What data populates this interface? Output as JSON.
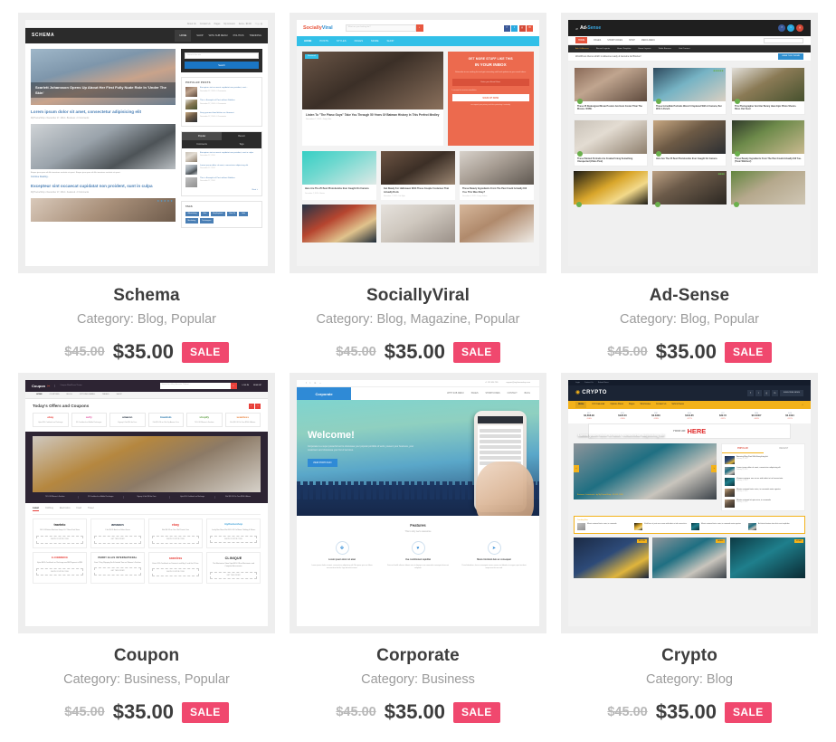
{
  "page": {
    "title": "Theme Shop Product Grid"
  },
  "products": [
    {
      "name": "Schema",
      "category_label": "Category: Blog, Popular",
      "old_price": "$45.00",
      "price": "$35.00",
      "sale_badge": "SALE",
      "theme": "schema",
      "preview": {
        "logo": "SCHEMA",
        "topbar_links": [
          "About Us",
          "Contact Us",
          "Pages",
          "My Account",
          "Items - $0.00"
        ],
        "nav": [
          "HOME",
          "SHOP",
          "WITH SUB MENU",
          "POLITICS",
          "TRENDING"
        ],
        "hero_headline": "Scarlett Johansson Opens Up About Her First Fully Nude Role In 'Under The Skin'",
        "post_title_1": "Lorem ipsum dolor sit amet, consectetur adipisicing elit",
        "post_meta_1": "MyThemeShop  •  December 17, 2014  •  Business  •  0 Comments",
        "post_excerpt": "Eaque ipsa quae ab illo inventore veritatis et quasi. Eaque ipsa quae ab illo inventore veritatis et quasi.",
        "read_more": "Continue Reading...",
        "post_title_2": "Excepteur sint occaecat cupidatat non proident, sunt in culpa",
        "post_meta_2": "MyThemeShop  •  December 17, 2014  •  Featured  •  0 Comments",
        "search_placeholder": "Search this site",
        "search_button": "Search",
        "widget_popular": "POPULAR POSTS",
        "popular_items": [
          "Excepteur sint occaecat cupidatat non proident, sunt...",
          "This is Example of Post without Sidebar",
          "Sexy gourmet food dishes on Gourmet"
        ],
        "tabs": [
          "Popular",
          "Recent",
          "Comments",
          "Tags"
        ],
        "tab_items": [
          "Excepteur sint occaecat cupidatat non proident, sunt in culpa",
          "Lorem ipsum dolor sit amet, consectetur adipisicing elit",
          "This is Example of Post without Sidebar"
        ],
        "next_link": "Next »",
        "widget_tags": "TAGS",
        "tags": [
          "Advertising",
          "Geo",
          "Employment",
          "How To",
          "Jobs",
          "Marketing",
          "Techniques"
        ]
      }
    },
    {
      "name": "SociallyViral",
      "category_label": "Category: Blog, Magazine, Popular",
      "old_price": "$45.00",
      "price": "$35.00",
      "sale_badge": "SALE",
      "theme": "sociallyviral",
      "preview": {
        "logo_a": "Socially",
        "logo_b": "Viral",
        "search_placeholder": "What are you looking for?",
        "nav": [
          "HOME",
          "POSTS",
          "STYLES",
          "PAGES",
          "MORE",
          "SHOP"
        ],
        "featured_badge": "Featured",
        "hero_title": "Listen To \"The Piano Guys\" Take You Through 50 Years Of Batman History In This Perfect Medley",
        "hero_meta": "December 7, 2015  •  Daily Vibe",
        "optin_line1": "GET MORE STUFF LIKE THIS",
        "optin_line2": "IN YOUR INBOX",
        "optin_desc": "Subscribe to our mailing list and get interesting stuff and updates to your email inbox.",
        "optin_input": "Enter your Email Here",
        "optin_consent": "I consent to receive newsletter",
        "optin_button": "SIGN UP NOW",
        "optin_note": "we respect your privacy and take protecting it seriously",
        "cards": [
          {
            "title": "Here Are The 25 Best Photobombs Ever Caught On Camera",
            "meta": "December 7, 2015  •  Stories"
          },
          {
            "title": "Get Ready For Halloween With These Couple Costumes That Actually Rock.",
            "meta": "November 7, 2015  •  Life Style"
          },
          {
            "title": "These Beauty Ingredients From The Past Could Actually Kill You. This Was Okay?",
            "meta": "December 4, 2015  •  Funny Videos"
          }
        ]
      }
    },
    {
      "name": "Ad-Sense",
      "category_label": "Category: Blog, Popular",
      "old_price": "$45.00",
      "price": "$35.00",
      "sale_badge": "SALE",
      "theme": "adsense",
      "preview": {
        "logo_a": "Ad-",
        "logo_b": "Sense",
        "nav": [
          "HOME",
          "PAGES",
          "SHORTCODES",
          "SHOP",
          "MEDIA MENU"
        ],
        "subnav": [
          "Ads & Adsense",
          "Recent Layouts",
          "Home Template",
          "Home Layouts",
          "Tablet Banners",
          "Grid Content"
        ],
        "notice": "WordPress theme which is Adsense ready & Genuine Ad Blocker!",
        "cta_button": "GRAB THIS THEME",
        "cards": [
          "These 25 Redesigned Movie Posters Are Even Cooler Than The Movies. WOW.",
          "These Incredible Portraits Weren't Captured With A Camera, But With A Pencil.",
          "This Photographer And Her Bunny Have Epic Photo Shoots. Bless Out Feed",
          "These Painted Portraits Are Created Using Something Unexpected (Video Post)",
          "Here Are The 25 Best Photobombs Ever Caught On Camera",
          "These Beauty Ingredients From The Past Could Actually Kill You. (Toxic Witches!)"
        ]
      }
    },
    {
      "name": "Coupon",
      "category_label": "Category: Business, Popular",
      "old_price": "$45.00",
      "price": "$35.00",
      "sale_badge": "SALE",
      "theme": "coupon",
      "preview": {
        "logo": "Coupon",
        "tagline": "Coupon WordPress Theme",
        "search_placeholder": "Search for eBay, Amazon, Flipkart...",
        "login": "LOG IN",
        "signup": "SIGN UP",
        "nav": [
          "HOME",
          "COUPONS",
          "BLOG",
          "OPTIONS PANEL",
          "PAGES",
          "SHOP"
        ],
        "heading": "Today's Offers and Coupons",
        "top_offers": [
          {
            "brand": "ebay",
            "desc": "Upto 40% Cashback on Recharge"
          },
          {
            "brand": "sulfy",
            "desc": "$5 Cashback on Mobile Recharges"
          },
          {
            "brand": "amazon",
            "desc": "Signup & Get $10 for Free"
          },
          {
            "brand": "travelolo",
            "desc": "Flat $20 Off on Ola City Amaze Cars"
          },
          {
            "brand": "shopify",
            "desc": "70% Off Women's Fashion"
          },
          {
            "brand": "seamless",
            "desc": "Flat $20 Off On Your $200 & Above"
          }
        ],
        "tabs": [
          "Latest",
          "Clothing",
          "Electronics",
          "Food",
          "Travel"
        ],
        "coupons": [
          {
            "brand": "traeteio",
            "desc": "10% Off Entire Machine Group LLC Store First Store",
            "btn": "SHOW COUPON CODE"
          },
          {
            "brand": "amazon",
            "desc": "3 for $9.99 Each on Select Items",
            "btn": "GET THIS OFFER"
          },
          {
            "brand": "ebay",
            "desc": "Flat $6 Off on One Ola Private Cars",
            "btn": "SHOW COUPON CODE"
          },
          {
            "brand": "mythemeshop",
            "desc": "Lucky Star Store Flat 50% Off On Mens Clothing & Shoes",
            "btn": "SHOW COUPON CODE"
          },
          {
            "brand": "E-COMMERCE",
            "desc": "Upto 400% Cashback on Recharge and Bill Payment of $20",
            "btn": "SHOW COUPON CODE"
          },
          {
            "brand": "PERRY ELLIS INTERNATIONAL",
            "desc": "Free 2 Day Shipping For A Limited Time on Women's Fashion",
            "btn": "GET THIS OFFER"
          },
          {
            "brand": "seamless",
            "desc": "Extra 10% Cashback on Domino's and Buy 1 and Get 1 Free",
            "btn": "SHOW COUPON CODE"
          },
          {
            "brand": "CLINIQUE",
            "desc": "The Electronics Store Upto 80% Off on Electronics and Computer Accessories",
            "btn": "GET THIS OFFER"
          }
        ]
      }
    },
    {
      "name": "Corporate",
      "category_label": "Category: Business",
      "old_price": "$45.00",
      "price": "$35.00",
      "sale_badge": "SALE",
      "theme": "corporate",
      "preview": {
        "logo": "Corporate",
        "topbar_phone": "+1 123 456 789",
        "topbar_email": "support@mythemeshop.com",
        "nav": [
          "WITH SUB MENU",
          "PAGES",
          "SHORTCODES",
          "CONTACT",
          "BLOG"
        ],
        "hero_title": "Welcome!",
        "hero_desc": "Corporate is a super powerful tool to showcase your popular portfolio of work, present your business, your customers and showcase your list of services.",
        "hero_button": "VIEW PORTFOLIO",
        "features_title": "Features",
        "features_sub": "This is why we're awesome",
        "features": [
          {
            "title": "Lorem ipsum dolor sit amet",
            "desc": "Lorem ipsum dolor sit amet, consectetur adipisicing elit. Nisi quae quis nisi libero accusantium facilis, fuga ad amet earum."
          },
          {
            "title": "Use conditioned cupiditat",
            "desc": "Duis sed mollit ullamco laboris nisi ut aliquip ex ea commodo consequat deserunt voluptate."
          },
          {
            "title": "Mavis tincidunt duis ac consequat",
            "desc": "Proin bibendum, dui ac consequat viverra, ipsum est lobortis ut magna, quis tincidunt neque mauris non sed."
          }
        ]
      }
    },
    {
      "name": "Crypto",
      "category_label": "Category: Blog",
      "old_price": "$45.00",
      "price": "$35.00",
      "sale_badge": "SALE",
      "theme": "crypto",
      "preview": {
        "topbar_links": [
          "Login",
          "Contact Us",
          "Submit News"
        ],
        "logo": "CRYPTO",
        "header_button": "SUBSCRIBE NEWS",
        "nav": [
          "Home",
          "ICO Calendar",
          "Options Panel",
          "Pages",
          "Shortcodes",
          "Contact Us",
          "Submit News"
        ],
        "ticker": [
          {
            "symbol": "BTC",
            "price": "$3,668.99",
            "change": "-1.06%"
          },
          {
            "symbol": "ETH",
            "price": "$126.00",
            "change": "-1.94%"
          },
          {
            "symbol": "XRP",
            "price": "$0.3329",
            "change": "-1.28%"
          },
          {
            "symbol": "BCH",
            "price": "$134.85",
            "change": "-3.77%"
          },
          {
            "symbol": "LTC",
            "price": "$32.15",
            "change": "-1.87%"
          },
          {
            "symbol": "XEM",
            "price": "$0.04307",
            "change": "-3.43%"
          },
          {
            "symbol": "XLM",
            "price": "$0.1094",
            "change": "-2.17%"
          }
        ],
        "ad_line1": "YOUR AD",
        "ad_line2": "HERE",
        "hero_title": "Lorem ipsum dolor sit amet, consectetur adipisicing elit",
        "hero_meta": "Business, Investment  •  by MyThemeShop  •  19,419, 2018",
        "sidebar_tabs": [
          "POPULAR",
          "RECENT"
        ],
        "sidebar_items": [
          "Amazing Blog Post With Everything Init",
          "Lorem ipsum dolor sit amet, consectetur adipisicing elit",
          "Vivamus quisque non eu mo mibi viderit et ad consectetur",
          "Mauris euismod tortor enim, in commodo enim egestas",
          "Mauris euismod sit quis enim, in commodo"
        ],
        "trending_label": "Trending Now",
        "trending": [
          "Mauris euismod tortor enim, in commodo",
          "Vivid lines ut justo nec ornare mibi vderis et ad consectetur.",
          "Mauris euismod tortor enim, in commodo enim egestas",
          "Architecto beatae vitae dicta sunt explicabo"
        ],
        "card_tags": [
          "BITCOIN",
          "MINING",
          "ETHER"
        ]
      }
    }
  ]
}
